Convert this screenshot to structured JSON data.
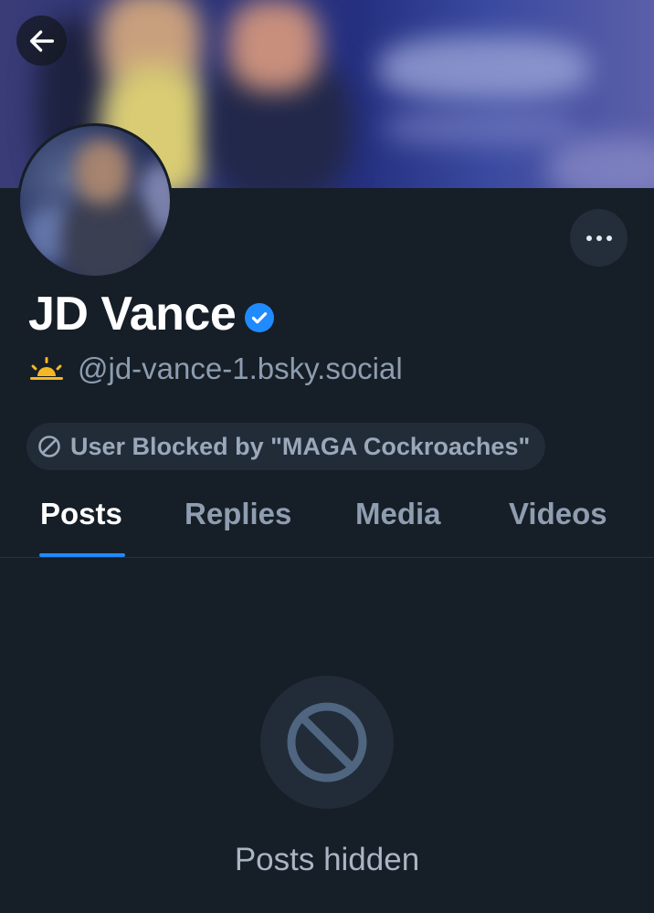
{
  "profile": {
    "display_name": "JD Vance",
    "handle": "@jd-vance-1.bsky.social",
    "verified": true,
    "handle_prefix_icon": "sunrise-icon"
  },
  "moderation": {
    "blocked_label": "User Blocked by \"MAGA Cockroaches\""
  },
  "tabs": [
    {
      "label": "Posts",
      "active": true
    },
    {
      "label": "Replies",
      "active": false
    },
    {
      "label": "Media",
      "active": false
    },
    {
      "label": "Videos",
      "active": false
    }
  ],
  "empty_state": {
    "icon": "block-icon",
    "text": "Posts hidden"
  },
  "colors": {
    "background": "#161e27",
    "accent": "#208bfe",
    "verified": "#208bfe",
    "sunrise": "#f5b824",
    "muted_text": "#8d9db0"
  }
}
